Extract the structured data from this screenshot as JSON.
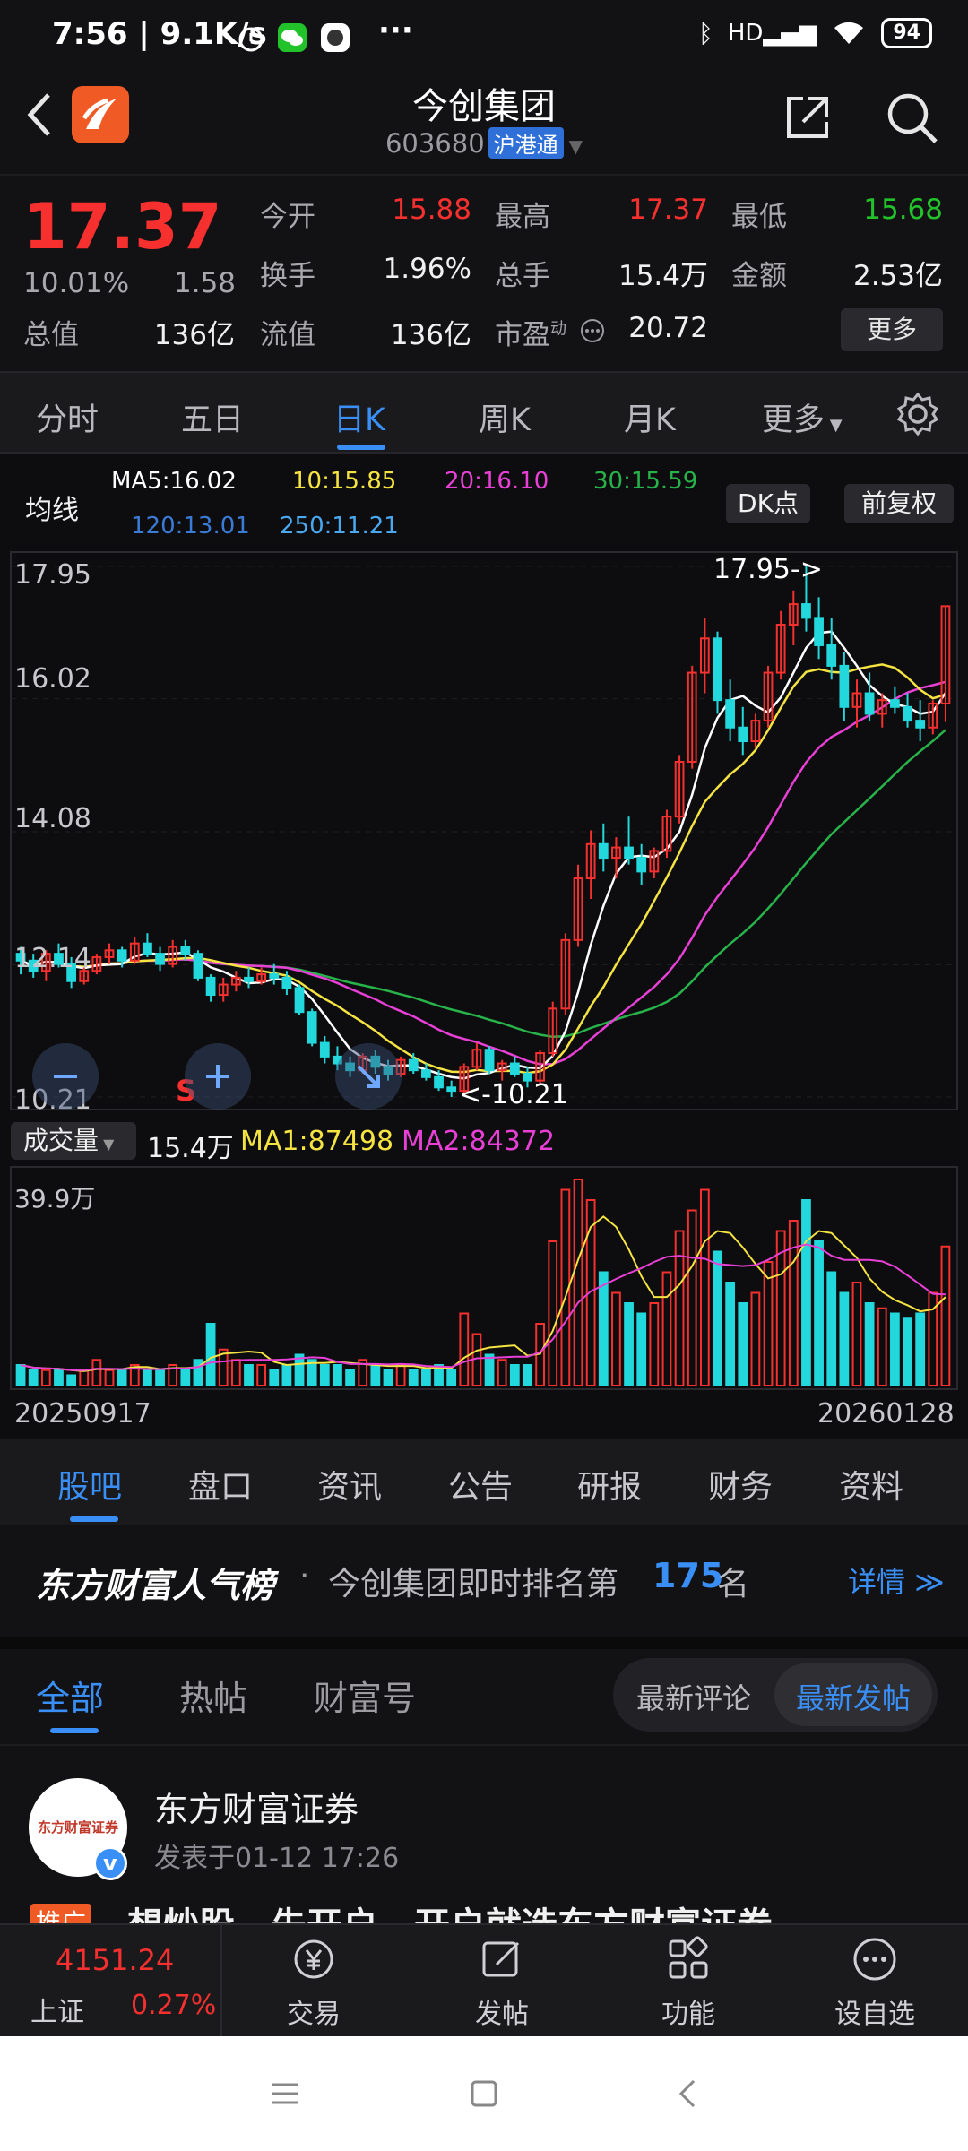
{
  "status": {
    "time": "7:56",
    "speed": "9.1K/s",
    "battery": "94",
    "dots": "···"
  },
  "header": {
    "title": "今创集团",
    "code": "603680",
    "badge": "沪港通"
  },
  "quote": {
    "price": "17.37",
    "change_pct": "10.01%",
    "change": "1.58",
    "open_label": "今开",
    "open": "15.88",
    "high_label": "最高",
    "high": "17.37",
    "low_label": "最低",
    "low": "15.68",
    "turnover_label": "换手",
    "turnover": "1.96%",
    "volume_label": "总手",
    "volume": "15.4万",
    "amount_label": "金额",
    "amount": "2.53亿",
    "mcap_label": "总值",
    "mcap": "136亿",
    "float_label": "流值",
    "float": "136亿",
    "pe_label": "市盈",
    "pe_sup": "动",
    "pe": "20.72",
    "more": "更多"
  },
  "period_tabs": [
    "分时",
    "五日",
    "日K",
    "周K",
    "月K",
    "更多"
  ],
  "ma": {
    "label": "均线",
    "ma5": "MA5:16.02",
    "ma10": "10:15.85",
    "ma20": "20:16.10",
    "ma30": "30:15.59",
    "ma120": "120:13.01",
    "ma250": "250:11.21",
    "dk": "DK点",
    "fq": "前复权"
  },
  "colors": {
    "up": "#f5302e",
    "down": "#22d8dc",
    "ma5": "#ffffff",
    "ma10": "#f5e342",
    "ma20": "#e840d6",
    "ma30": "#28b34a",
    "ma120": "#3a7bd5",
    "ma250": "#4aa8f0",
    "accent": "#3a8ff6"
  },
  "chart_data": {
    "type": "candlestick",
    "y_ticks": [
      "17.95",
      "16.02",
      "14.08",
      "12.14",
      "10.21"
    ],
    "ylim": [
      10.21,
      17.95
    ],
    "x_start": "20250917",
    "x_end": "20260128",
    "high_annotation": "17.95->",
    "low_annotation": "<-10.21",
    "volume": {
      "label": "成交量",
      "current": "15.4万",
      "ma1": "MA1:87498",
      "ma2": "MA2:84372",
      "max_tick": "39.9万"
    },
    "candles": [
      [
        12.3,
        12.4,
        12.0,
        12.2
      ],
      [
        12.2,
        12.3,
        11.95,
        12.05
      ],
      [
        12.05,
        12.35,
        11.9,
        12.3
      ],
      [
        12.3,
        12.45,
        12.1,
        12.15
      ],
      [
        12.15,
        12.25,
        11.8,
        11.9
      ],
      [
        11.9,
        12.1,
        11.85,
        12.05
      ],
      [
        12.05,
        12.3,
        12.0,
        12.25
      ],
      [
        12.25,
        12.45,
        12.15,
        12.35
      ],
      [
        12.35,
        12.4,
        12.1,
        12.2
      ],
      [
        12.2,
        12.55,
        12.15,
        12.45
      ],
      [
        12.45,
        12.6,
        12.25,
        12.3
      ],
      [
        12.3,
        12.4,
        12.05,
        12.15
      ],
      [
        12.15,
        12.5,
        12.1,
        12.4
      ],
      [
        12.4,
        12.5,
        12.2,
        12.3
      ],
      [
        12.3,
        12.35,
        11.9,
        11.95
      ],
      [
        11.95,
        12.0,
        11.6,
        11.7
      ],
      [
        11.7,
        11.95,
        11.6,
        11.85
      ],
      [
        11.85,
        12.05,
        11.75,
        11.95
      ],
      [
        11.95,
        12.1,
        11.8,
        11.9
      ],
      [
        11.9,
        12.1,
        11.85,
        12.0
      ],
      [
        12.0,
        12.15,
        11.85,
        11.95
      ],
      [
        11.95,
        12.05,
        11.7,
        11.8
      ],
      [
        11.8,
        11.85,
        11.4,
        11.45
      ],
      [
        11.45,
        11.5,
        10.95,
        11.0
      ],
      [
        11.0,
        11.1,
        10.7,
        10.8
      ],
      [
        10.8,
        10.95,
        10.6,
        10.7
      ],
      [
        10.7,
        10.8,
        10.5,
        10.6
      ],
      [
        10.6,
        10.85,
        10.55,
        10.8
      ],
      [
        10.8,
        10.9,
        10.55,
        10.65
      ],
      [
        10.65,
        10.75,
        10.45,
        10.55
      ],
      [
        10.55,
        10.8,
        10.5,
        10.75
      ],
      [
        10.75,
        10.85,
        10.55,
        10.6
      ],
      [
        10.6,
        10.7,
        10.45,
        10.5
      ],
      [
        10.5,
        10.6,
        10.3,
        10.35
      ],
      [
        10.35,
        10.45,
        10.21,
        10.3
      ],
      [
        10.3,
        10.7,
        10.25,
        10.65
      ],
      [
        10.65,
        11.0,
        10.6,
        10.9
      ],
      [
        10.9,
        10.95,
        10.55,
        10.6
      ],
      [
        10.6,
        10.75,
        10.45,
        10.7
      ],
      [
        10.7,
        10.8,
        10.5,
        10.55
      ],
      [
        10.55,
        10.65,
        10.35,
        10.45
      ],
      [
        10.45,
        10.9,
        10.4,
        10.85
      ],
      [
        10.85,
        11.6,
        10.8,
        11.5
      ],
      [
        11.5,
        12.6,
        11.4,
        12.5
      ],
      [
        12.5,
        13.6,
        12.4,
        13.4
      ],
      [
        13.4,
        14.1,
        13.1,
        13.9
      ],
      [
        13.9,
        14.2,
        13.5,
        13.7
      ],
      [
        13.7,
        14.0,
        13.4,
        13.85
      ],
      [
        13.85,
        14.3,
        13.6,
        13.7
      ],
      [
        13.7,
        13.9,
        13.3,
        13.5
      ],
      [
        13.5,
        13.85,
        13.4,
        13.8
      ],
      [
        13.8,
        14.4,
        13.7,
        14.3
      ],
      [
        14.3,
        15.2,
        14.2,
        15.1
      ],
      [
        15.1,
        16.5,
        15.0,
        16.4
      ],
      [
        16.4,
        17.2,
        16.1,
        16.9
      ],
      [
        16.9,
        17.0,
        15.8,
        16.0
      ],
      [
        16.0,
        16.3,
        15.4,
        15.6
      ],
      [
        15.6,
        15.9,
        15.2,
        15.4
      ],
      [
        15.4,
        15.8,
        15.3,
        15.7
      ],
      [
        15.7,
        16.5,
        15.6,
        16.4
      ],
      [
        16.4,
        17.3,
        16.3,
        17.1
      ],
      [
        17.1,
        17.6,
        16.8,
        17.4
      ],
      [
        17.4,
        17.95,
        17.0,
        17.2
      ],
      [
        17.2,
        17.5,
        16.6,
        16.8
      ],
      [
        16.8,
        17.2,
        16.3,
        16.5
      ],
      [
        16.5,
        16.7,
        15.7,
        15.9
      ],
      [
        15.9,
        16.3,
        15.6,
        16.1
      ],
      [
        16.1,
        16.4,
        15.7,
        15.8
      ],
      [
        15.8,
        16.1,
        15.6,
        16.0
      ],
      [
        16.0,
        16.2,
        15.8,
        15.9
      ],
      [
        15.9,
        16.1,
        15.6,
        15.7
      ],
      [
        15.7,
        16.0,
        15.4,
        15.6
      ],
      [
        15.6,
        16.0,
        15.5,
        15.95
      ],
      [
        15.95,
        17.37,
        15.68,
        17.37
      ]
    ],
    "volumes": [
      4,
      3,
      3,
      3,
      2,
      3,
      5,
      3,
      3,
      4,
      3,
      3,
      4,
      3,
      5,
      12,
      7,
      5,
      4,
      4,
      3,
      4,
      6,
      5,
      4,
      4,
      3,
      5,
      4,
      3,
      4,
      3,
      3,
      4,
      3,
      14,
      10,
      6,
      5,
      4,
      4,
      12,
      28,
      38,
      40,
      36,
      22,
      18,
      16,
      14,
      16,
      22,
      30,
      34,
      38,
      26,
      20,
      16,
      18,
      24,
      30,
      32,
      36,
      28,
      22,
      18,
      20,
      16,
      15,
      14,
      13,
      14,
      18,
      27
    ]
  },
  "info_tabs": [
    "股吧",
    "盘口",
    "资讯",
    "公告",
    "研报",
    "财务",
    "资料"
  ],
  "rank": {
    "brand": "东方财富人气榜",
    "sep": "·",
    "text": "今创集团即时排名第",
    "num": "175",
    "unit": "名",
    "detail": "详情"
  },
  "feed_tabs": [
    "全部",
    "热帖",
    "财富号"
  ],
  "feed_sort": [
    "最新评论",
    "最新发帖"
  ],
  "post": {
    "author": "东方财富证券",
    "avatar_text": "东方财富证券",
    "time": "发表于01-12 17:26",
    "tag": "推广",
    "title": "想炒股，先开户，开户就选东方财富证券"
  },
  "bottom_bar": {
    "index_value": "4151.24",
    "index_name": "上证",
    "index_change": "0.27%",
    "items": [
      "交易",
      "发帖",
      "功能",
      "设自选"
    ]
  }
}
